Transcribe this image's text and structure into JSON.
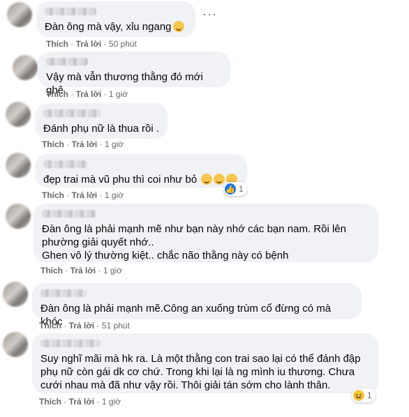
{
  "action_labels": {
    "like": "Thích",
    "reply": "Trả lời"
  },
  "comments": [
    {
      "text": "Đàn ông mà vậy, xỉu ngang",
      "time": "50 phút"
    },
    {
      "text": "Vậy mà vẫn thương thằng đó mới ghê",
      "time": "1 giờ"
    },
    {
      "text": "Đánh phụ nữ là thua rồi .",
      "time": "1 giờ"
    },
    {
      "text": "đẹp trai mà vũ phu thì coi như bỏ",
      "time": "1 giờ",
      "reaction_count": "1"
    },
    {
      "text": "Đàn ông là phải mạnh mẽ như bạn này nhớ các bạn nam. Rồi lên\nphường giải quyết nhớ..\nGhen vô lý thường kiệt.. chắc não thằng này có bệnh",
      "time": "1 giờ"
    },
    {
      "text": "Đàn ông là phải mạnh mẽ.Công an xuống trùm cổ đừng có mà khóc",
      "time": "51 phút"
    },
    {
      "text": "Suy nghĩ mãi mà hk ra. Là một thằng con trai sao lại có thể đánh đập\nphụ nữ còn gái dk cơ chứ. Trong khi lại là ng mình iu thương. Chưa\ncưới nhau mà đã như vậy rồi. Thôi giải tán sớm cho lành thân.",
      "time": "1 giờ",
      "reaction_count": "1"
    }
  ],
  "more_options": "···"
}
